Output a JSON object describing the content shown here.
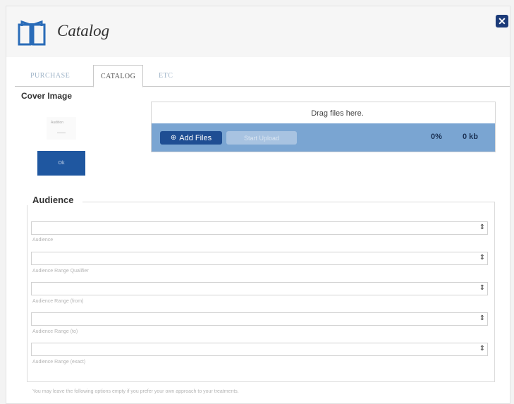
{
  "dialog": {
    "title": "Catalog",
    "icon": "book-icon",
    "close_icon": "close-icon",
    "close_glyph": "✕"
  },
  "tabs": [
    {
      "label": "PURCHASE"
    },
    {
      "label": "CATALOG",
      "active": true
    },
    {
      "label": "ETC"
    }
  ],
  "cover": {
    "label": "Cover Image",
    "thumb_text": "Audition",
    "blue_text": "Ok"
  },
  "upload": {
    "drop_text": "Drag files here.",
    "add_files_label": "Add Files",
    "start_upload_label": "Start Upload",
    "percent": "0%",
    "size": "0 kb"
  },
  "audience": {
    "legend": "Audience",
    "fields": [
      {
        "label": "Audience",
        "value": ""
      },
      {
        "label": "Audience Range Qualifier",
        "value": ""
      },
      {
        "label": "Audience Range (from)",
        "value": ""
      },
      {
        "label": "Audience Range (to)",
        "value": ""
      },
      {
        "label": "Audience Range (exact)",
        "value": ""
      }
    ],
    "select_arrow": "⇕"
  },
  "footnote": "You may leave the following options empty if you prefer your own approach to your treatments.",
  "colors": {
    "accent": "#1f57a0",
    "upload_bar": "#7aa5d2",
    "close_bg": "#1b3a78"
  }
}
